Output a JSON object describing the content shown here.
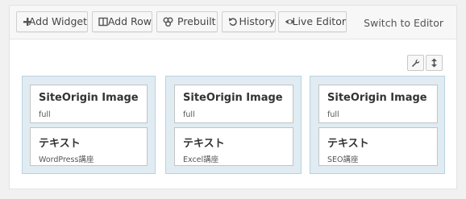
{
  "toolbar": {
    "buttons": [
      {
        "label": "Add Widget",
        "icon": "plus-icon"
      },
      {
        "label": "Add Row",
        "icon": "columns-icon"
      },
      {
        "label": "Prebuilt",
        "icon": "group-icon"
      },
      {
        "label": "History",
        "icon": "undo-icon"
      },
      {
        "label": "Live Editor",
        "icon": "eye-icon"
      }
    ],
    "switch_label": "Switch to Editor"
  },
  "row_actions": {
    "edit_icon": "wrench-icon",
    "move_icon": "vertical-arrows-icon"
  },
  "cells": [
    {
      "widgets": [
        {
          "title": "SiteOrigin Image",
          "description": "full"
        },
        {
          "title": "テキスト",
          "description": "WordPress講座"
        }
      ]
    },
    {
      "widgets": [
        {
          "title": "SiteOrigin Image",
          "description": "full"
        },
        {
          "title": "テキスト",
          "description": "Excel講座"
        }
      ]
    },
    {
      "widgets": [
        {
          "title": "SiteOrigin Image",
          "description": "full"
        },
        {
          "title": "テキスト",
          "description": "SEO講座"
        }
      ]
    }
  ],
  "colors": {
    "cell_background": "#e0ecf2",
    "cell_border": "#b9d3df",
    "toolbar_background": "#f7f7f7"
  }
}
